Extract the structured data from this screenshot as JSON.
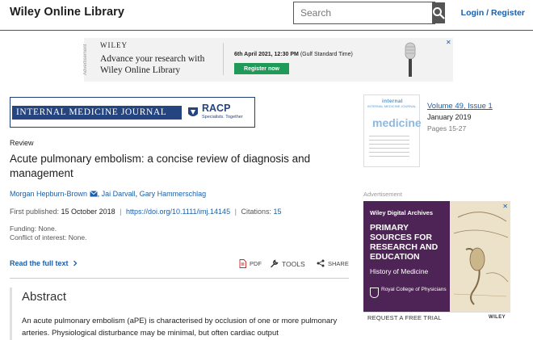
{
  "header": {
    "brand": "Wiley Online Library",
    "search_placeholder": "Search",
    "login": "Login / Register"
  },
  "top_ad": {
    "vertical_label": "Advertisement",
    "logo": "WILEY",
    "headline": "Advance your research with Wiley Online Library",
    "date": "6th April 2021, 12:30 PM",
    "timezone": " (Gulf Standard Time)",
    "button": "Register now",
    "close": "✕"
  },
  "journal": {
    "name": "INTERNAL MEDICINE JOURNAL",
    "partner": "RACP",
    "partner_tagline": "Specialists. Together"
  },
  "article": {
    "type": "Review",
    "title": "Acute pulmonary embolism: a concise review of diagnosis and management",
    "authors": [
      "Morgan Hepburn-Brown",
      "Jai Darvall",
      "Gary Hammerschlag"
    ],
    "first_published_label": "First published:",
    "first_published": "15 October 2018",
    "doi": "https://doi.org/10.1111/imj.14145",
    "citations_label": "Citations:",
    "citations": "15",
    "funding": "Funding: None.",
    "conflict": "Conflict of interest: None.",
    "read_full_text": "Read the full text",
    "pdf": "PDF",
    "tools": "TOOLS",
    "share": "SHARE"
  },
  "abstract": {
    "title": "Abstract",
    "text": "An acute pulmonary embolism (aPE) is characterised by occlusion of one or more pulmonary arteries. Physiological disturbance may be minimal, but often cardiac output"
  },
  "issue": {
    "volume_label": "Volume 49, Issue 1",
    "date": "January 2019",
    "pages": "Pages 15-27",
    "cover_title": "internal",
    "cover_sub": "INTERNAL MEDICINE JOURNAL",
    "cover_word": "medicine"
  },
  "side_ad": {
    "label": "Advertisement",
    "head": "Wiley Digital Archives",
    "big": "PRIMARY SOURCES FOR RESEARCH AND EDUCATION",
    "sub": "History of Medicine",
    "logo": "Royal College of Physicians",
    "request": "REQUEST A FREE TRIAL",
    "wiley": "WILEY",
    "close": "✕"
  },
  "colors": {
    "link": "#1b5faa",
    "brand_navy": "#24457f",
    "ad_purple": "#4e2355",
    "ad_green": "#1f9a59"
  }
}
